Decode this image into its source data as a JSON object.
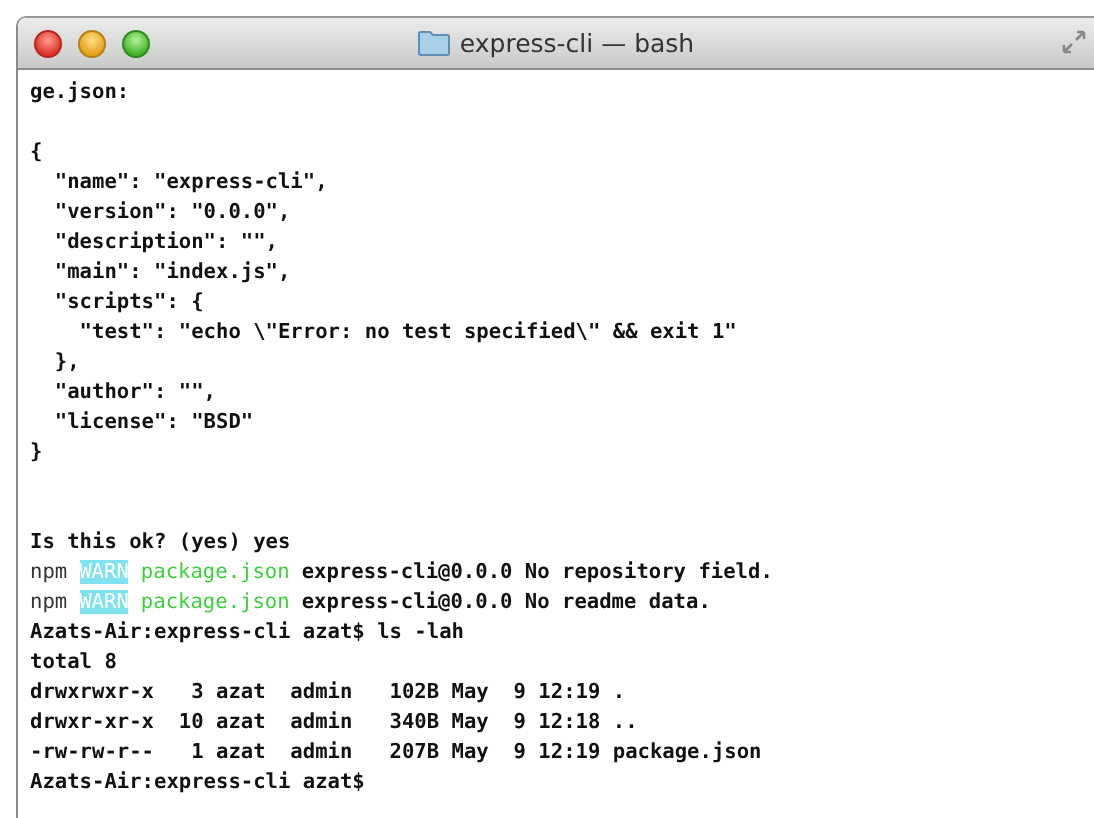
{
  "window": {
    "title": "express-cli — bash"
  },
  "terminal": {
    "lines": [
      {
        "kind": "text",
        "segments": [
          {
            "kind": "plain",
            "text": "ge.json:"
          }
        ]
      },
      {
        "kind": "blank"
      },
      {
        "kind": "text",
        "segments": [
          {
            "kind": "plain",
            "text": "{"
          }
        ]
      },
      {
        "kind": "text",
        "segments": [
          {
            "kind": "plain",
            "text": "  \"name\": \"express-cli\","
          }
        ]
      },
      {
        "kind": "text",
        "segments": [
          {
            "kind": "plain",
            "text": "  \"version\": \"0.0.0\","
          }
        ]
      },
      {
        "kind": "text",
        "segments": [
          {
            "kind": "plain",
            "text": "  \"description\": \"\","
          }
        ]
      },
      {
        "kind": "text",
        "segments": [
          {
            "kind": "plain",
            "text": "  \"main\": \"index.js\","
          }
        ]
      },
      {
        "kind": "text",
        "segments": [
          {
            "kind": "plain",
            "text": "  \"scripts\": {"
          }
        ]
      },
      {
        "kind": "text",
        "segments": [
          {
            "kind": "plain",
            "text": "    \"test\": \"echo \\\"Error: no test specified\\\" && exit 1\""
          }
        ]
      },
      {
        "kind": "text",
        "segments": [
          {
            "kind": "plain",
            "text": "  },"
          }
        ]
      },
      {
        "kind": "text",
        "segments": [
          {
            "kind": "plain",
            "text": "  \"author\": \"\","
          }
        ]
      },
      {
        "kind": "text",
        "segments": [
          {
            "kind": "plain",
            "text": "  \"license\": \"BSD\""
          }
        ]
      },
      {
        "kind": "text",
        "segments": [
          {
            "kind": "plain",
            "text": "}"
          }
        ]
      },
      {
        "kind": "blank"
      },
      {
        "kind": "blank"
      },
      {
        "kind": "text",
        "segments": [
          {
            "kind": "plain",
            "text": "Is this ok? (yes) yes"
          }
        ]
      },
      {
        "kind": "text",
        "segments": [
          {
            "kind": "dim",
            "text": "npm"
          },
          {
            "kind": "warn",
            "text": "WARN"
          },
          {
            "kind": "green",
            "text": "package.json"
          },
          {
            "kind": "plain",
            "text": "express-cli@0.0.0 No repository field."
          }
        ]
      },
      {
        "kind": "text",
        "segments": [
          {
            "kind": "dim",
            "text": "npm"
          },
          {
            "kind": "warn",
            "text": "WARN"
          },
          {
            "kind": "green",
            "text": "package.json"
          },
          {
            "kind": "plain",
            "text": "express-cli@0.0.0 No readme data."
          }
        ]
      },
      {
        "kind": "text",
        "segments": [
          {
            "kind": "plain",
            "text": "Azats-Air:express-cli azat$ ls -lah"
          }
        ]
      },
      {
        "kind": "text",
        "segments": [
          {
            "kind": "plain",
            "text": "total 8"
          }
        ]
      },
      {
        "kind": "text",
        "segments": [
          {
            "kind": "plain",
            "text": "drwxrwxr-x   3 azat  admin   102B May  9 12:19 ."
          }
        ]
      },
      {
        "kind": "text",
        "segments": [
          {
            "kind": "plain",
            "text": "drwxr-xr-x  10 azat  admin   340B May  9 12:18 .."
          }
        ]
      },
      {
        "kind": "text",
        "segments": [
          {
            "kind": "plain",
            "text": "-rw-rw-r--   1 azat  admin   207B May  9 12:19 package.json"
          }
        ]
      },
      {
        "kind": "text",
        "segments": [
          {
            "kind": "plain",
            "text": "Azats-Air:express-cli azat$"
          }
        ]
      }
    ]
  }
}
